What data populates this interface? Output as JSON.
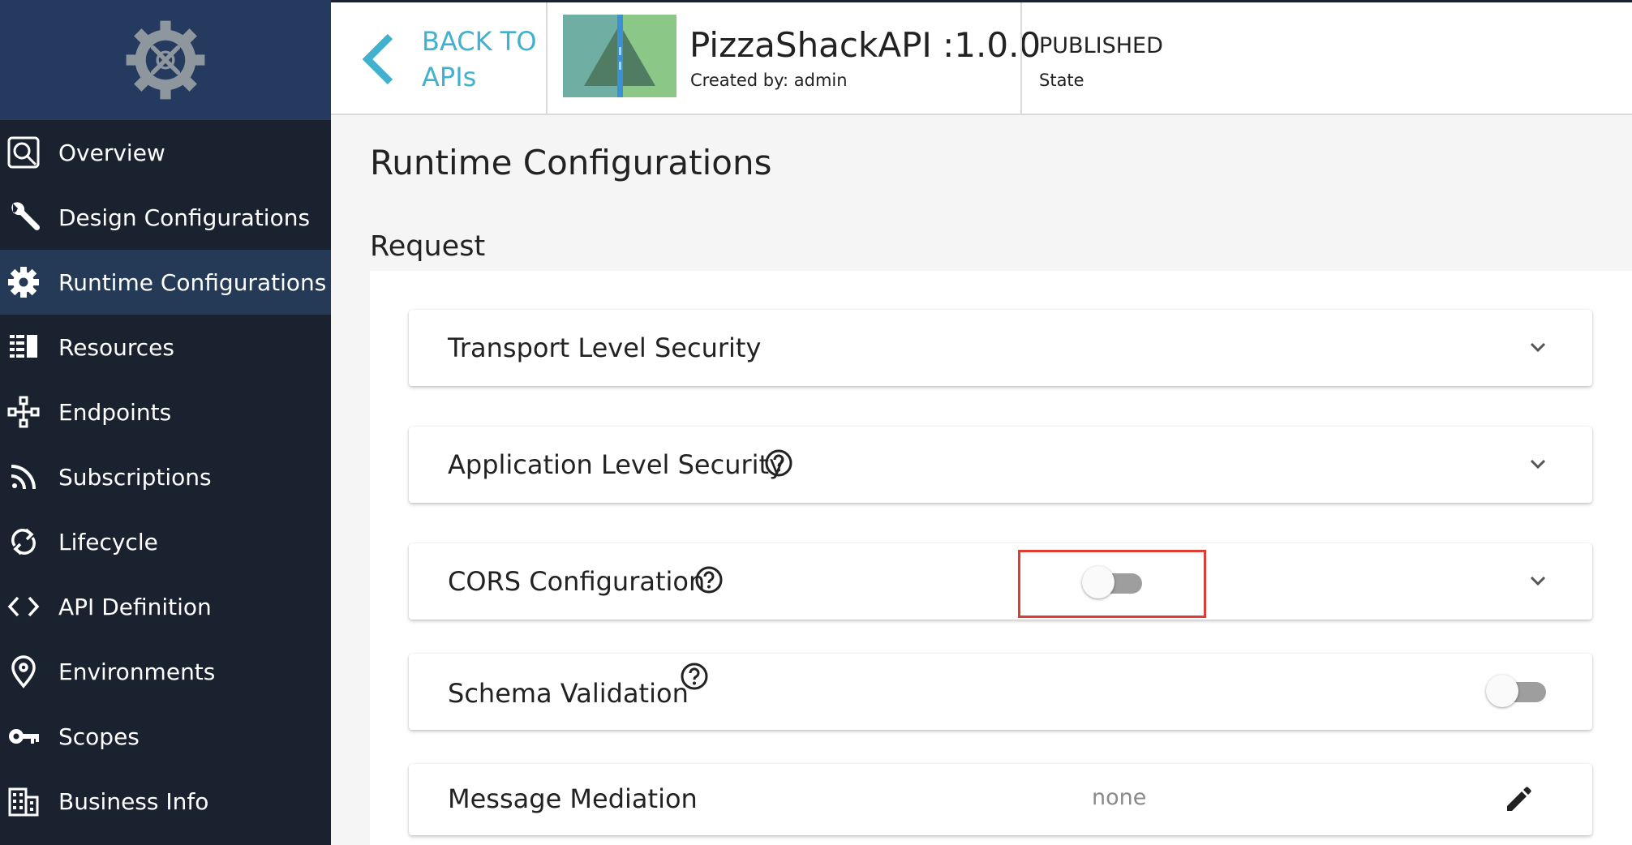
{
  "sidebar": {
    "items": [
      {
        "label": "Overview",
        "icon": "overview-icon"
      },
      {
        "label": "Design Configurations",
        "icon": "wrench-icon"
      },
      {
        "label": "Runtime Configurations",
        "icon": "gear-icon",
        "active": true
      },
      {
        "label": "Resources",
        "icon": "resources-icon"
      },
      {
        "label": "Endpoints",
        "icon": "endpoints-icon"
      },
      {
        "label": "Subscriptions",
        "icon": "rss-icon"
      },
      {
        "label": "Lifecycle",
        "icon": "sync-icon"
      },
      {
        "label": "API Definition",
        "icon": "code-icon"
      },
      {
        "label": "Environments",
        "icon": "location-pin-icon"
      },
      {
        "label": "Scopes",
        "icon": "key-icon"
      },
      {
        "label": "Business Info",
        "icon": "building-icon"
      }
    ]
  },
  "header": {
    "back_label": "BACK TO APIs",
    "api_name": "PizzaShackAPI :1.0.0",
    "created_by": "Created by: admin",
    "state_value": "PUBLISHED",
    "state_label": "State"
  },
  "main": {
    "page_title": "Runtime Configurations",
    "section_title": "Request",
    "cards": {
      "transport": {
        "title": "Transport Level Security"
      },
      "application": {
        "title": "Application Level Security"
      },
      "cors": {
        "title": "CORS Configuration",
        "enabled": false
      },
      "schema": {
        "title": "Schema Validation",
        "enabled": false
      },
      "mediation": {
        "title": "Message Mediation",
        "value": "none"
      }
    }
  },
  "colors": {
    "sidebar_bg": "#1a2230",
    "logo_bg": "#243a5e",
    "active_bg": "#253a57",
    "accent": "#42b1cf",
    "highlight": "#e03c31"
  }
}
